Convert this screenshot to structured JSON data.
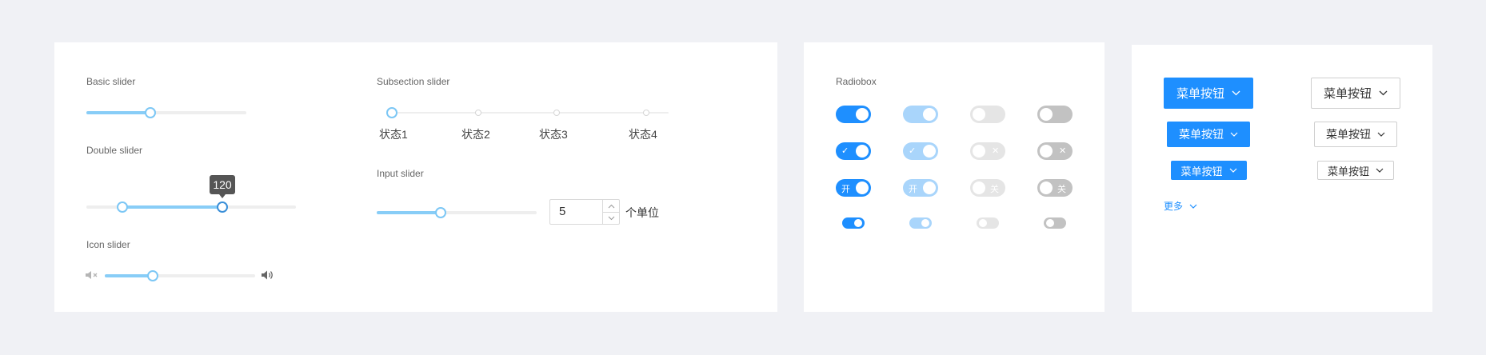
{
  "slider_panel": {
    "basic": {
      "label": "Basic slider",
      "value_fraction": 0.4
    },
    "double": {
      "label": "Double slider",
      "tooltip": "120",
      "low_fraction": 0.17,
      "high_fraction": 0.65
    },
    "icon": {
      "label": "Icon slider",
      "mute_icon": "volume-mute-icon",
      "loud_icon": "volume-up-icon",
      "value_fraction": 0.32
    },
    "subsection": {
      "label": "Subsection slider",
      "states": [
        "状态1",
        "状态2",
        "状态3",
        "状态4"
      ],
      "selected_index": 0
    },
    "input": {
      "label": "Input slider",
      "value": "5",
      "unit": "个单位",
      "value_fraction": 0.4
    }
  },
  "switch_panel": {
    "label": "Radiobox",
    "check_mark": "✓",
    "cross_mark": "✕",
    "on_text": "开",
    "off_text": "关",
    "colors": {
      "on": "#1e8fff",
      "on_disabled": "#a9d5fb",
      "off_disabled": "#e5e5e5",
      "off": "#c2c2c2"
    }
  },
  "menu_panel": {
    "large_primary": "菜单按钮",
    "medium_primary": "菜单按钮",
    "small_primary": "菜单按钮",
    "large_default": "菜单按钮",
    "medium_default": "菜单按钮",
    "small_default": "菜单按钮",
    "more_link": "更多",
    "accent": "#1e8fff"
  }
}
